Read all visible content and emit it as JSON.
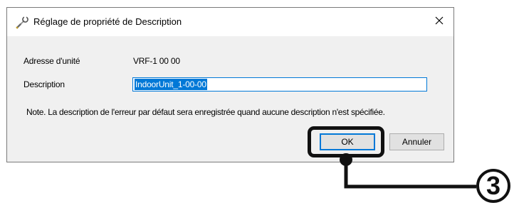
{
  "dialog": {
    "title": "Réglage de propriété de Description",
    "title_icon": "wrench-key-icon",
    "close_icon": "close-icon",
    "unit_address_label": "Adresse d'unité",
    "unit_address_value": "VRF-1 00 00",
    "description_label": "Description",
    "description_value": "IndoorUnit_1-00-00",
    "note": "Note. La description de l'erreur par défaut sera enregistrée quand aucune description n'est spécifiée.",
    "ok_label": "OK",
    "cancel_label": "Annuler"
  },
  "annotation": {
    "step_number": "3",
    "color": "#111111"
  },
  "colors": {
    "accent": "#0078d7",
    "dialog_bg": "#f0f0f0",
    "button_bg": "#e1e1e1"
  }
}
